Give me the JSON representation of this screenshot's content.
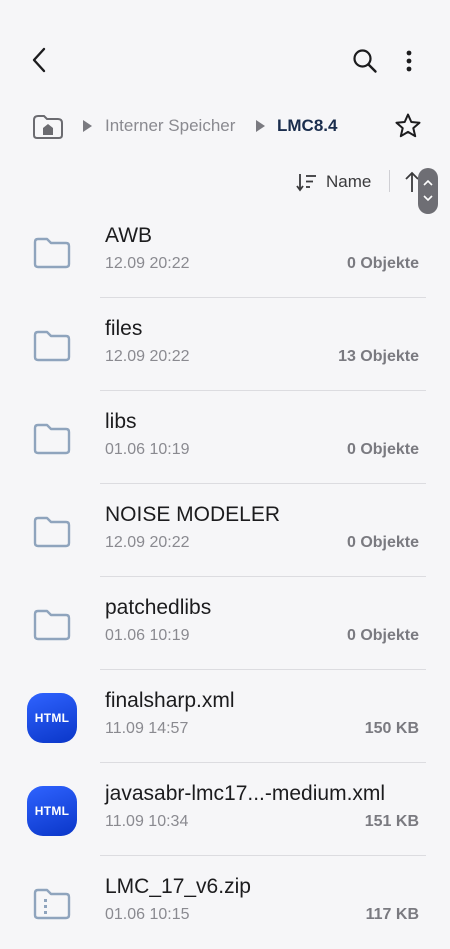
{
  "breadcrumb": {
    "internal_storage": "Interner Speicher",
    "current_folder": "LMC8.4"
  },
  "sort": {
    "label": "Name"
  },
  "files": [
    {
      "name": "AWB",
      "date": "12.09 20:22",
      "size": "0 Objekte",
      "type": "folder"
    },
    {
      "name": "files",
      "date": "12.09 20:22",
      "size": "13 Objekte",
      "type": "folder"
    },
    {
      "name": "libs",
      "date": "01.06 10:19",
      "size": "0 Objekte",
      "type": "folder"
    },
    {
      "name": "NOISE MODELER",
      "date": "12.09 20:22",
      "size": "0 Objekte",
      "type": "folder"
    },
    {
      "name": "patchedlibs",
      "date": "01.06 10:19",
      "size": "0 Objekte",
      "type": "folder"
    },
    {
      "name": "finalsharp.xml",
      "date": "11.09 14:57",
      "size": "150 KB",
      "type": "html",
      "badge": "HTML"
    },
    {
      "name": "javasabr-lmc17...-medium.xml",
      "date": "11.09 10:34",
      "size": "151 KB",
      "type": "html",
      "badge": "HTML"
    },
    {
      "name": "LMC_17_v6.zip",
      "date": "01.06 10:15",
      "size": "117 KB",
      "type": "zip"
    }
  ],
  "colors": {
    "background": "#f6f6f8",
    "folder_icon": "#8fa4bd",
    "html_badge": "#1e4cf0",
    "breadcrumb_current": "#1a2d4d"
  }
}
